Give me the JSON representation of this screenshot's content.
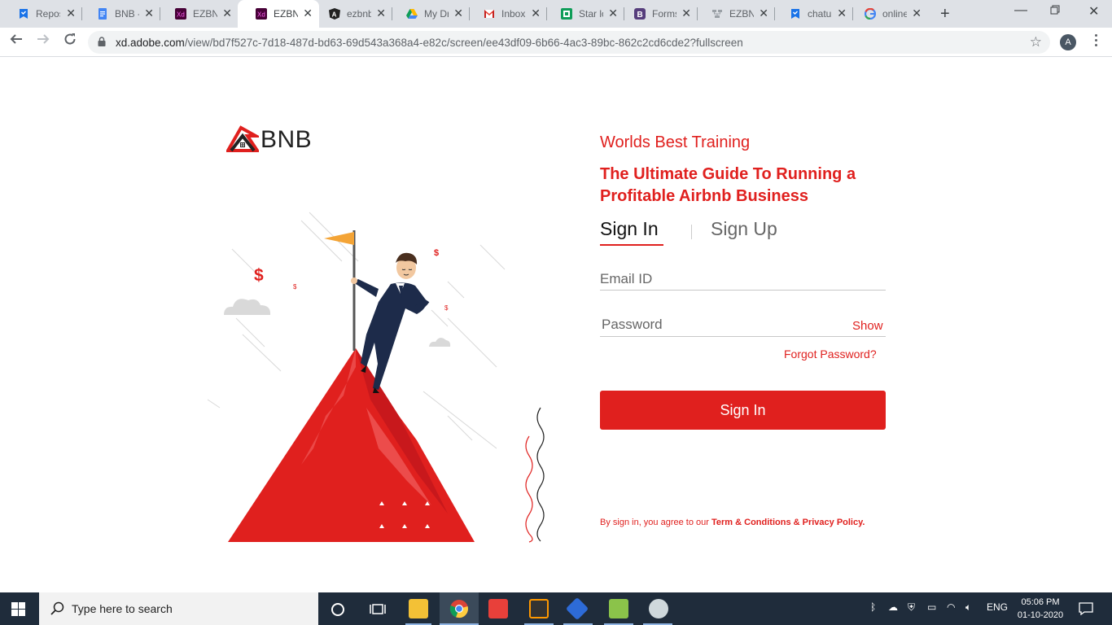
{
  "browser": {
    "tabs": [
      {
        "label": "Repos",
        "icon": "bookmark-icon",
        "color": "#1a73e8"
      },
      {
        "label": "BNB -",
        "icon": "google-docs-icon",
        "color": "#4285f4"
      },
      {
        "label": "EZBNI",
        "icon": "adobe-xd-icon",
        "color": "#470137"
      },
      {
        "label": "EZBNI",
        "icon": "adobe-xd-icon",
        "color": "#470137"
      },
      {
        "label": "ezbnb",
        "icon": "angular-icon",
        "color": "#222222"
      },
      {
        "label": "My Dr",
        "icon": "google-drive-icon",
        "color": "#0f9d58"
      },
      {
        "label": "Inbox",
        "icon": "gmail-icon",
        "color": "#ea4335"
      },
      {
        "label": "Star lo",
        "icon": "star-app-icon",
        "color": "#0f9d58"
      },
      {
        "label": "Forms",
        "icon": "bootstrap-icon",
        "color": "#563d7c"
      },
      {
        "label": "EZBN",
        "icon": "sitemap-icon",
        "color": "#9aa0a6"
      },
      {
        "label": "chatu",
        "icon": "bookmark-icon",
        "color": "#1a73e8"
      },
      {
        "label": "online",
        "icon": "google-icon",
        "color": "#4285f4"
      }
    ],
    "active_tab_index": 3,
    "url_host": "xd.adobe.com",
    "url_path": "/view/bd7f527c-7d18-487d-bd63-69d543a368a4-e82c/screen/ee43df09-6b66-4ac3-89bc-862c2cd6cde2?fullscreen",
    "profile_initial": "A"
  },
  "page": {
    "logo_text": "BNB",
    "tagline": "Worlds Best Training",
    "headline": "The Ultimate Guide To Running a Profitable Airbnb Business",
    "tab_signin": "Sign In",
    "tab_signup": "Sign Up",
    "email_placeholder": "Email ID",
    "password_placeholder": "Password",
    "show_label": "Show",
    "forgot_label": "Forgot Password?",
    "signin_button": "Sign In",
    "terms_prefix": "By sign in, you agree to our",
    "terms_link": "Term & Conditions & Privacy Policy.",
    "accent_color": "#e0201e"
  },
  "taskbar": {
    "search_placeholder": "Type here to search",
    "language": "ENG",
    "time": "05:06 PM",
    "date": "01-10-2020",
    "apps": [
      "cortana-icon",
      "task-view-icon",
      "file-explorer-icon",
      "chrome-icon",
      "git-client-icon",
      "sublime-text-icon",
      "sourcetree-icon",
      "notepad-plus-icon",
      "paint-icon"
    ]
  }
}
